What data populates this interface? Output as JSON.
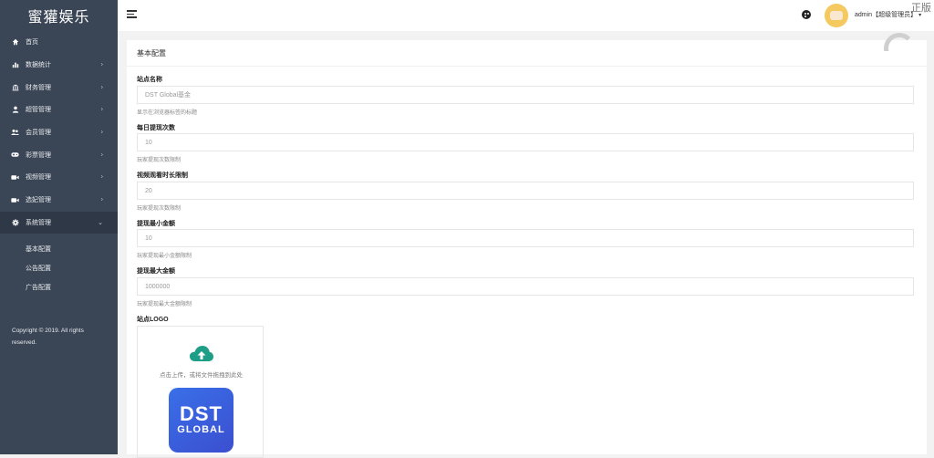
{
  "sidebar": {
    "brand": "蜜獾娱乐",
    "items": [
      {
        "label": "首页",
        "icon": "home-icon",
        "has_arrow": false
      },
      {
        "label": "数据统计",
        "icon": "bar-chart-icon",
        "has_arrow": true
      },
      {
        "label": "财务管理",
        "icon": "bank-icon",
        "has_arrow": true
      },
      {
        "label": "超管管理",
        "icon": "user-icon",
        "has_arrow": true
      },
      {
        "label": "会员管理",
        "icon": "users-icon",
        "has_arrow": true
      },
      {
        "label": "彩票管理",
        "icon": "gamepad-icon",
        "has_arrow": true
      },
      {
        "label": "视频管理",
        "icon": "video-icon",
        "has_arrow": true
      },
      {
        "label": "选妃管理",
        "icon": "video-icon",
        "has_arrow": true
      },
      {
        "label": "系统管理",
        "icon": "gear-icon",
        "has_arrow": true,
        "expanded": true
      }
    ],
    "subitems": [
      {
        "label": "基本配置"
      },
      {
        "label": "公告配置"
      },
      {
        "label": "广告配置"
      }
    ],
    "copyright": "Copyright © 2019. All rights reserved."
  },
  "topbar": {
    "user": "admin【超级管理员】",
    "corner_text": "正版"
  },
  "panel": {
    "title": "基本配置",
    "fields": [
      {
        "label": "站点名称",
        "value": "DST Global基金",
        "help": "显示在浏览器标签的标题"
      },
      {
        "label": "每日提现次数",
        "value": "10",
        "help": "玩家提现次数限制"
      },
      {
        "label": "视频观看时长限制",
        "value": "20",
        "help": "玩家提现次数限制"
      },
      {
        "label": "提现最小金额",
        "value": "10",
        "help": "玩家提现最小金额限制"
      },
      {
        "label": "提现最大金额",
        "value": "1000000",
        "help": "玩家提现最大金额限制"
      }
    ],
    "logo_label": "站点LOGO",
    "upload_text": "点击上传，或将文件拖拽到此处",
    "logo_line1": "DST",
    "logo_line2": "GLOBAL"
  },
  "colors": {
    "sidebar_bg": "#3a4556",
    "upload_icon": "#1e9e86",
    "logo_bg": "#3b5ee0"
  }
}
